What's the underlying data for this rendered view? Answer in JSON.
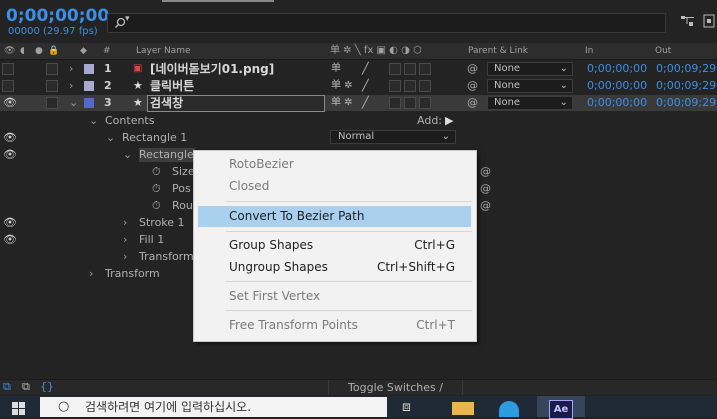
{
  "timecode": "0;00;00;00",
  "fps_line": "00000 (29.97 fps)",
  "search_placeholder": "",
  "headers": {
    "hash": "#",
    "layer_name": "Layer Name",
    "parent": "Parent & Link",
    "in": "In",
    "out": "Out"
  },
  "layers": [
    {
      "num": "1",
      "name": "[네이버돋보기01.png]",
      "label_color": "#a9a9cf",
      "parent": "None",
      "in": "0;00;00;00",
      "out": "0;00;09;29"
    },
    {
      "num": "2",
      "name": "클릭버튼",
      "label_color": "#a9a9cf",
      "parent": "None",
      "in": "0;00;00;00",
      "out": "0;00;09;29"
    },
    {
      "num": "3",
      "name": "검색창",
      "label_color": "#5566cc",
      "parent": "None",
      "in": "0;00;00;00",
      "out": "0;00;09;29"
    }
  ],
  "tree": {
    "contents": "Contents",
    "add": "Add:",
    "rect1": "Rectangle 1",
    "blend_mode": "Normal",
    "rect_path": "Rectangle",
    "size": "Size",
    "pos": "Pos",
    "roundness": "Rou",
    "stroke": "Stroke 1",
    "fill": "Fill 1",
    "transform_inner": "Transform",
    "transform": "Transform"
  },
  "menu": {
    "roto": "RotoBezier",
    "closed": "Closed",
    "convert": "Convert To Bezier Path",
    "group": "Group Shapes",
    "group_key": "Ctrl+G",
    "ungroup": "Ungroup Shapes",
    "ungroup_key": "Ctrl+Shift+G",
    "set_first": "Set First Vertex",
    "free_transform": "Free Transform Points",
    "free_key": "Ctrl+T"
  },
  "toggle_label": "Toggle Switches / Modes",
  "taskbar": {
    "search_text": "검색하려면 여기에 입력하십시오."
  },
  "colors": {
    "accent_blue": "#3d8ee6",
    "menu_highlight": "#aad0f0"
  }
}
